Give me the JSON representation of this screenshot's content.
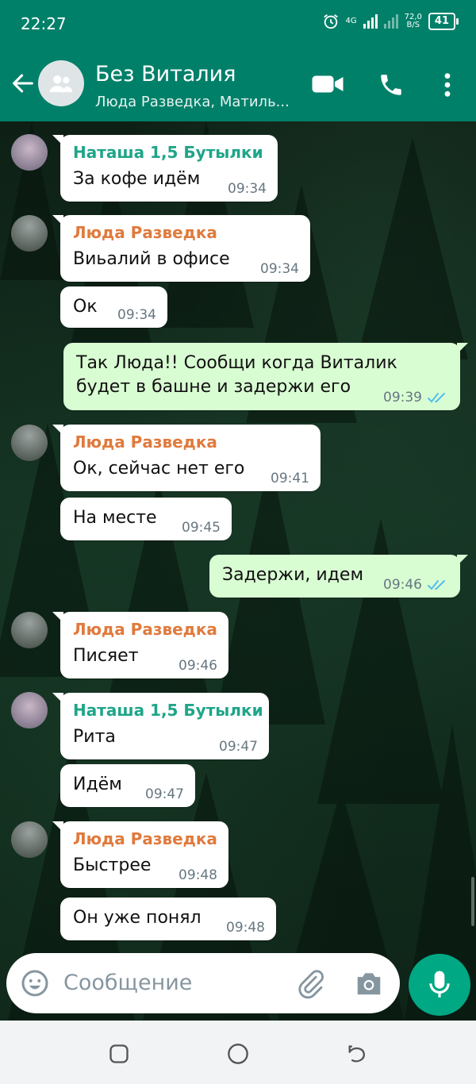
{
  "status_bar": {
    "time": "22:27",
    "network": "4G",
    "speed": "72,0",
    "speed_unit": "B/S",
    "battery": "41"
  },
  "header": {
    "title": "Без Виталия",
    "subtitle": "Люда Разведка, Матиль..."
  },
  "messages": [
    {
      "direction": "in",
      "sender": "Наташа 1,5 Бутылки",
      "sender_color": "#1fa589",
      "text": [
        "За кофе идём"
      ],
      "time": "09:34"
    },
    {
      "direction": "in",
      "sender": "Люда Разведка",
      "sender_color": "#e07a3c",
      "text": [
        "Виьалий в офисе"
      ],
      "time": "09:34"
    },
    {
      "direction": "in",
      "sender": "",
      "text": [
        "Ок"
      ],
      "time": "09:34"
    },
    {
      "direction": "out",
      "text": [
        "Так Люда!!  Сообщи когда Виталик",
        "будет в башне и задержи его"
      ],
      "time": "09:39",
      "status": "read"
    },
    {
      "direction": "in",
      "sender": "Люда Разведка",
      "sender_color": "#e07a3c",
      "text": [
        "Ок, сейчас нет его"
      ],
      "time": "09:41"
    },
    {
      "direction": "in",
      "sender": "",
      "text": [
        "На месте"
      ],
      "time": "09:45"
    },
    {
      "direction": "out",
      "text": [
        "Задержи, идем"
      ],
      "time": "09:46",
      "status": "read"
    },
    {
      "direction": "in",
      "sender": "Люда Разведка",
      "sender_color": "#e07a3c",
      "text": [
        "Писяет"
      ],
      "time": "09:46"
    },
    {
      "direction": "in",
      "sender": "Наташа 1,5 Бутылки",
      "sender_color": "#1fa589",
      "text": [
        "Рита"
      ],
      "time": "09:47"
    },
    {
      "direction": "in",
      "sender": "",
      "text": [
        "Идём"
      ],
      "time": "09:47"
    },
    {
      "direction": "in",
      "sender": "Люда Разведка",
      "sender_color": "#e07a3c",
      "text": [
        "Быстрее"
      ],
      "time": "09:48"
    },
    {
      "direction": "in",
      "sender": "",
      "text": [
        "Он уже понял"
      ],
      "time": "09:48"
    }
  ],
  "input": {
    "placeholder": "Сообщение"
  },
  "colors": {
    "brand": "#008069",
    "accent": "#00a884",
    "outgoing_bubble": "#d9fdd3",
    "read_ticks": "#53bdeb"
  }
}
